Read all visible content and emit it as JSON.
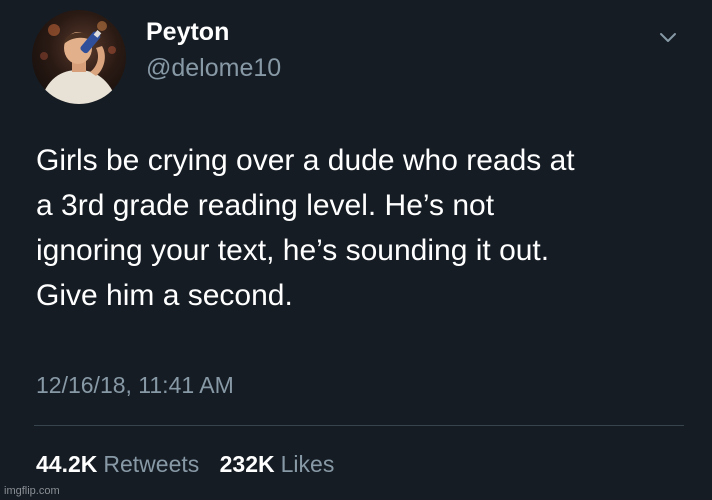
{
  "user": {
    "display_name": "Peyton",
    "handle": "@delome10"
  },
  "tweet": {
    "lines": [
      "Girls be crying over a dude who reads at",
      "a 3rd grade reading level. He’s not",
      "ignoring your text, he’s sounding it out.",
      "Give him a second."
    ],
    "timestamp": "12/16/18, 11:41 AM"
  },
  "stats": {
    "retweets_count": "44.2K",
    "retweets_label": "Retweets",
    "likes_count": "232K",
    "likes_label": "Likes"
  },
  "icons": {
    "menu": "chevron-down-icon"
  },
  "watermark": "imgflip.com",
  "colors": {
    "background": "#151c24",
    "secondary_text": "#8899a6",
    "divider": "#38444d"
  }
}
